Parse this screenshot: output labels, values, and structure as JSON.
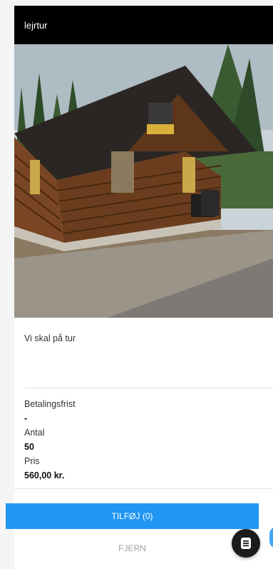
{
  "product": {
    "title": "lejrtur",
    "description": "Vi skal på tur",
    "deadline_label": "Betalingsfrist",
    "deadline_value": "-",
    "quantity_label": "Antal",
    "quantity_value": "50",
    "price_label": "Pris",
    "price_value": "560,00 kr."
  },
  "actions": {
    "add_label": "TILFØJ (0)",
    "remove_label": "FJERN"
  },
  "icons": {
    "fab": "list-icon"
  },
  "colors": {
    "header": "#000000",
    "primary": "#2196f3",
    "fab": "#1b1b1b"
  }
}
